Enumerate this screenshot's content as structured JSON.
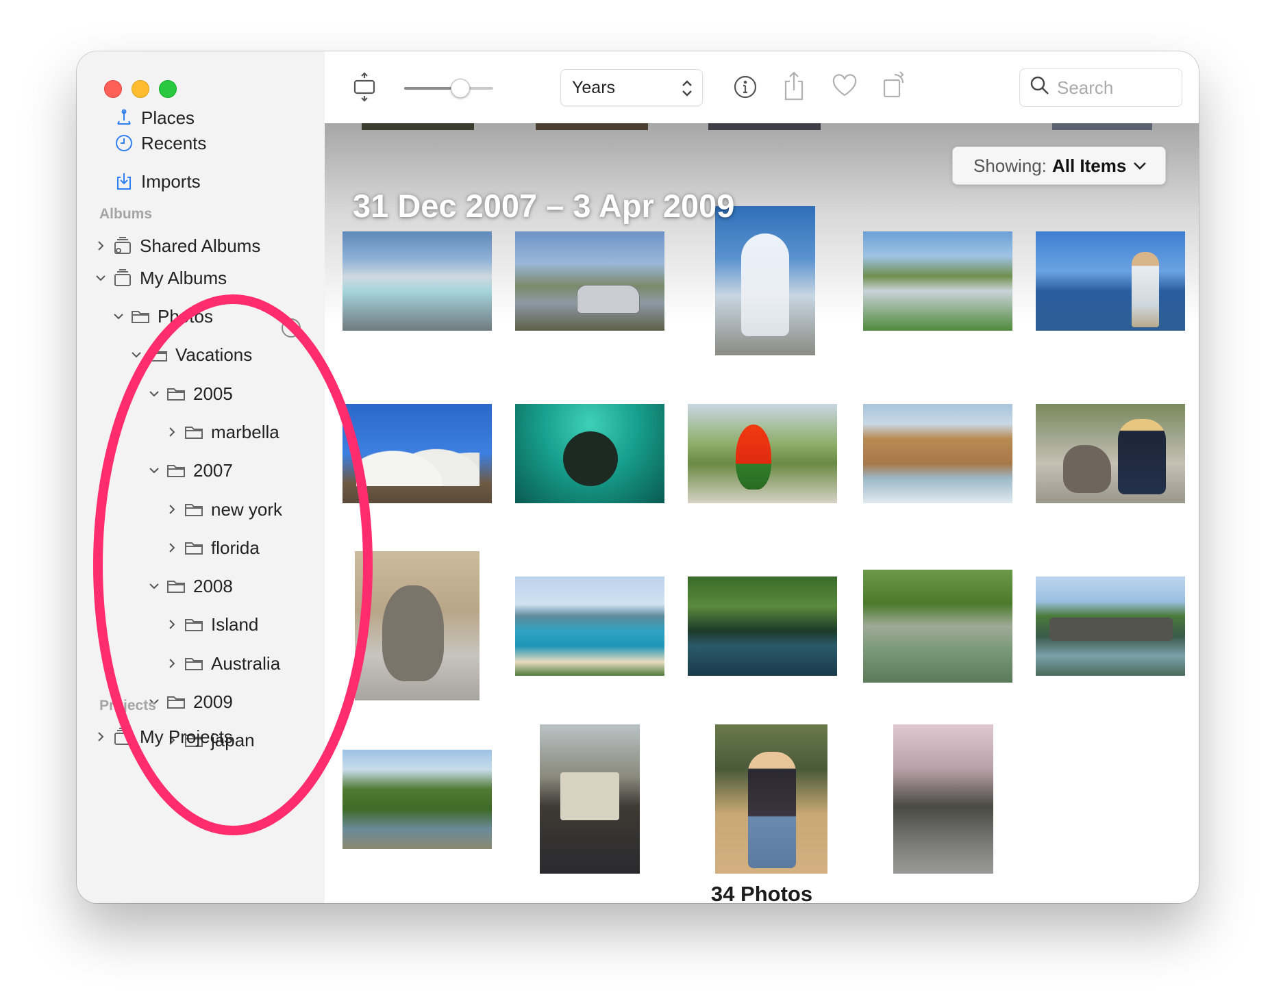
{
  "sidebar": {
    "library_items": [
      {
        "label": "Places",
        "icon": "map-pin-icon"
      },
      {
        "label": "Recents",
        "icon": "clock-icon"
      },
      {
        "label": "Imports",
        "icon": "import-icon"
      }
    ],
    "albums_header": "Albums",
    "shared_albums": "Shared Albums",
    "my_albums": "My Albums",
    "tree": [
      {
        "label": "Photos",
        "level": 1,
        "expanded": true
      },
      {
        "label": "Vacations",
        "level": 2,
        "expanded": true
      },
      {
        "label": "2005",
        "level": 3,
        "expanded": true
      },
      {
        "label": "marbella",
        "level": 4,
        "expanded": false
      },
      {
        "label": "2007",
        "level": 3,
        "expanded": true
      },
      {
        "label": "new york",
        "level": 4,
        "expanded": false
      },
      {
        "label": "florida",
        "level": 4,
        "expanded": false
      },
      {
        "label": "2008",
        "level": 3,
        "expanded": true
      },
      {
        "label": "Island",
        "level": 4,
        "expanded": false
      },
      {
        "label": "Australia",
        "level": 4,
        "expanded": false
      },
      {
        "label": "2009",
        "level": 3,
        "expanded": true
      },
      {
        "label": "japan",
        "level": 4,
        "expanded": false
      }
    ],
    "projects_header": "Projects",
    "my_projects": "My Projects"
  },
  "toolbar": {
    "view_mode": "Years",
    "zoom_level": 0.62,
    "search_placeholder": "Search"
  },
  "content": {
    "date_range": "31 Dec 2007 – 3 Apr 2009",
    "showing_label": "Showing:",
    "showing_value": "All Items",
    "photo_count": "34 Photos"
  },
  "colors": {
    "accent": "#2f7ff2",
    "annotation": "#ff2d6d",
    "traffic_close": "#fe5f57",
    "traffic_min": "#febc2e",
    "traffic_max": "#28c840"
  }
}
